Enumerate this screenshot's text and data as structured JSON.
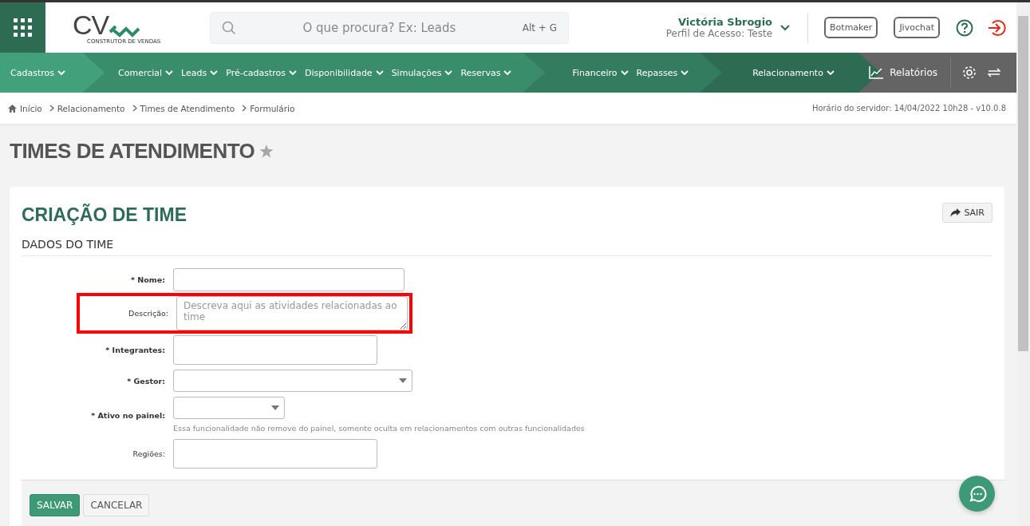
{
  "header": {
    "logo_text": "CV",
    "logo_subtitle": "CONSTRUTOR DE VENDAS",
    "search": {
      "placeholder": "O que procura? Ex: Leads",
      "shortcut": "Alt + G"
    },
    "user": {
      "name": "Victória Sbrogio",
      "profile": "Perfil de Acesso: Teste"
    },
    "buttons": [
      "Botmaker",
      "Jivochat"
    ]
  },
  "nav": {
    "groups": [
      {
        "items": [
          "Cadastros"
        ]
      },
      {
        "items": [
          "Comercial",
          "Leads",
          "Pré-cadastros",
          "Disponibilidade",
          "Simulações",
          "Reservas"
        ]
      },
      {
        "items": [
          "Financeiro",
          "Repasses"
        ]
      },
      {
        "items": [
          "Relacionamento"
        ]
      }
    ],
    "reports": "Relatórios"
  },
  "breadcrumb": [
    "Início",
    "Relacionamento",
    "Times de Atendimento",
    "Formulário"
  ],
  "server_time": "Horário do servidor: 14/04/2022 10h28 - v10.0.8",
  "page_title": "TIMES DE ATENDIMENTO",
  "card": {
    "title": "CRIAÇÃO DE TIME",
    "exit_button": "SAIR",
    "section": "DADOS DO TIME",
    "fields": [
      {
        "label": "* Nome:",
        "required": true,
        "kind": "text",
        "highlighted": false
      },
      {
        "label": "Descrição:",
        "required": false,
        "kind": "textarea",
        "placeholder": "Descreva aqui as atividades relacionadas ao time",
        "highlighted": true
      },
      {
        "label": "* Integrantes:",
        "required": true,
        "kind": "tags",
        "highlighted": false
      },
      {
        "label": "* Gestor:",
        "required": true,
        "kind": "select",
        "highlighted": false
      },
      {
        "label": "* Ativo no painel:",
        "required": true,
        "kind": "yesno",
        "help": "Essa funcionalidade não remove do painel, somente oculta em relacionamentos com outras funcionalidades",
        "highlighted": false
      },
      {
        "label": "Regiões:",
        "required": false,
        "kind": "tags",
        "highlighted": false
      }
    ],
    "save_button": "SALVAR",
    "cancel_button": "CANCELAR"
  }
}
